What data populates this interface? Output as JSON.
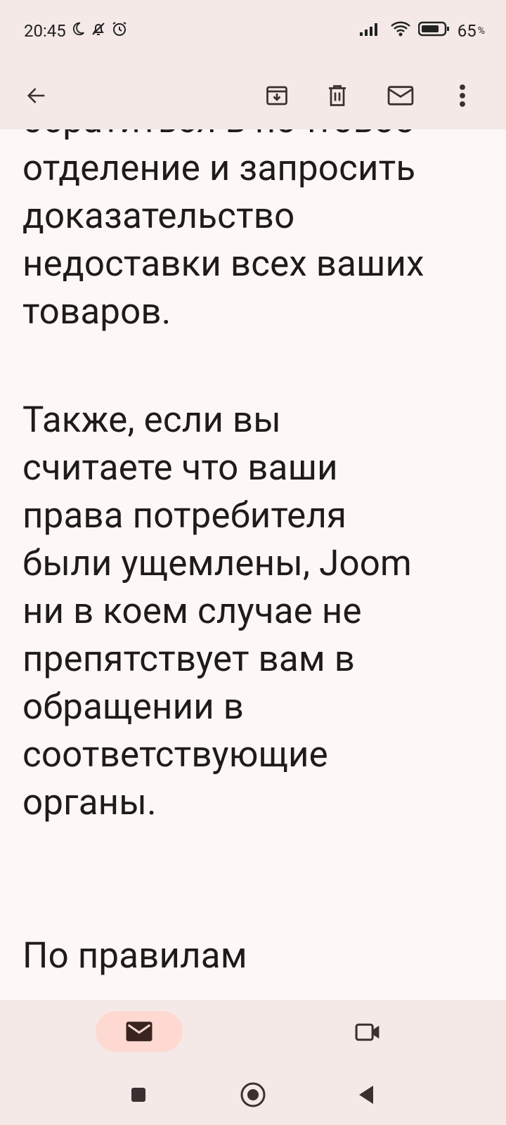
{
  "status_bar": {
    "time": "20:45",
    "battery": "65"
  },
  "toolbar": {
    "back_icon": "arrow-left-icon",
    "archive_icon": "archive-icon",
    "delete_icon": "trash-icon",
    "mark_unread_icon": "mail-icon",
    "more_icon": "more-vert-icon"
  },
  "email": {
    "paragraph_cut_top": "обратиться в почтовое",
    "paragraph_1": "отделение и запросить\nдоказательство\nнедоставки всех ваших\nтоваров.",
    "paragraph_2": "Также, если вы\nсчитаете что ваши\nправа потребителя\nбыли ущемлены, Joom\nни в коем случае не\nпрепятствует вам в\nобращении в\nсоответствующие\nорганы.",
    "paragraph_3": "По правилам"
  },
  "bottom_nav": {
    "mail_icon": "mail-icon",
    "meet_icon": "video-camera-icon"
  },
  "colors": {
    "bar_background": "#f4e9e7",
    "page_background": "#fdf8f7",
    "active_pill": "#fdd9d2",
    "text": "#1f1b1a"
  }
}
